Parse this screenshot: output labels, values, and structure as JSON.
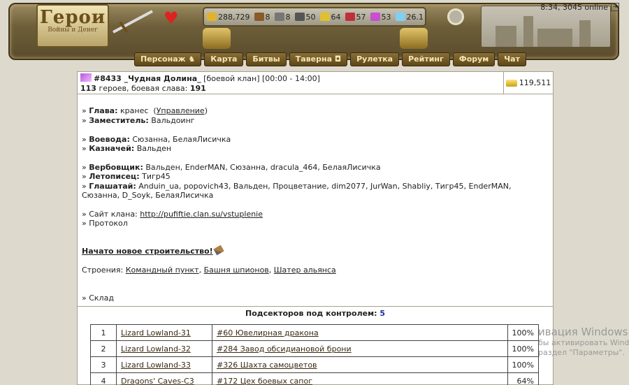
{
  "header": {
    "logo_title": "Герои",
    "logo_subtitle": "Войны и Денег",
    "online_status": "8:34, 3045 online",
    "resources": [
      {
        "icon": "gold-icon",
        "value": "288,729",
        "color": "#e0b32a"
      },
      {
        "icon": "wood-icon",
        "value": "8",
        "color": "#8a5a2b"
      },
      {
        "icon": "ore-icon",
        "value": "8",
        "color": "#777777"
      },
      {
        "icon": "mercury-icon",
        "value": "50",
        "color": "#555555"
      },
      {
        "icon": "sulfur-icon",
        "value": "64",
        "color": "#e0c030"
      },
      {
        "icon": "crystal-icon",
        "value": "57",
        "color": "#c0303a"
      },
      {
        "icon": "gems-icon",
        "value": "53",
        "color": "#c84fd0"
      },
      {
        "icon": "diamond-icon",
        "value": "26.1",
        "color": "#7fd0f0"
      }
    ]
  },
  "nav": [
    {
      "name": "nav-personage",
      "label": "Персонаж ♞"
    },
    {
      "name": "nav-map",
      "label": "Карта"
    },
    {
      "name": "nav-battles",
      "label": "Битвы"
    },
    {
      "name": "nav-tavern",
      "label": "Таверна ◘"
    },
    {
      "name": "nav-roulette",
      "label": "Рулетка"
    },
    {
      "name": "nav-rating",
      "label": "Рейтинг"
    },
    {
      "name": "nav-forum",
      "label": "Форум"
    },
    {
      "name": "nav-chat",
      "label": "Чат"
    }
  ],
  "clan": {
    "title": "#8433 _Чудная Долина_",
    "type": "[боевой клан] [00:00 - 14:00]",
    "heroes_count": "113",
    "heroes_text": " героев, боевая слава: ",
    "glory": "191",
    "gold": "119,511",
    "head_label": "Глава:",
    "head_value": "кранес",
    "manage_link": "Управление",
    "deputy_label": "Заместитель:",
    "deputy_value": "Вальдоинг",
    "voevoda_label": "Воевода:",
    "voevoda_value": "Сюзанна, БелаяЛисичка",
    "treasurer_label": "Казначей:",
    "treasurer_value": "Вальден",
    "recruiter_label": "Вербовщик:",
    "recruiter_value": "Вальден, EnderMAN, Сюзанна, dracula_464, БелаяЛисичка",
    "chronicler_label": "Летописец:",
    "chronicler_value": "Тигр45",
    "herald_label": "Глашатай:",
    "herald_value": "Anduin_ua, popovich43, Вальден, Процветание, dim2077, JurWan, Shabliy, Тигр45, EnderMAN, Сюзанна, D_Soyk, БелаяЛисичка",
    "site_label": "Сайт клана:",
    "site_url": "http://pufiftie.clan.su/vstuplenie",
    "protocol": "Протокол",
    "build_text": "Начато новое строительство!",
    "buildings_label": "Строения:",
    "buildings": [
      "Командный пункт",
      "Башня шпионов",
      "Шатер альянса"
    ],
    "warehouse": "Склад",
    "subsectors_label": "Подсекторов под контролем:",
    "subsectors_count": "5"
  },
  "subsectors": [
    {
      "num": "1",
      "name": "Lizard Lowland-31",
      "item": "#60 Ювелирная дракона",
      "pct": "100%"
    },
    {
      "num": "2",
      "name": "Lizard Lowland-32",
      "item": "#284 Завод обсидиановой брони",
      "pct": "100%"
    },
    {
      "num": "3",
      "name": "Lizard Lowland-33",
      "item": "#326 Шахта самоцветов",
      "pct": "100%"
    },
    {
      "num": "4",
      "name": "Dragons' Caves-C3",
      "item": "#172 Цех боевых сапог",
      "pct": "64%"
    }
  ],
  "watermark": {
    "line1": "ивация Windows",
    "line2": "бы активировать Windo",
    "line3": "раздел \"Параметры\"."
  }
}
